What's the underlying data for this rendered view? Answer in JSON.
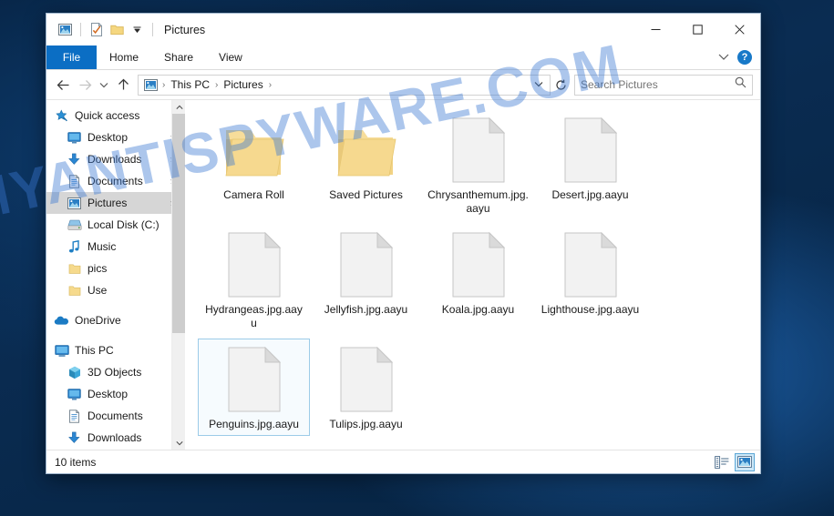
{
  "window": {
    "title": "Pictures",
    "quick_access": [
      {
        "name": "pictures-library-icon",
        "label": "Pictures library"
      },
      {
        "name": "properties-icon",
        "label": "Properties"
      },
      {
        "name": "new-folder-icon",
        "label": "New folder"
      },
      {
        "name": "customize-qat-icon",
        "label": "Customize Quick Access Toolbar"
      }
    ],
    "controls": {
      "minimize": "–",
      "maximize": "❐",
      "close": "✕"
    }
  },
  "ribbon": {
    "tabs": [
      {
        "label": "File",
        "active": true
      },
      {
        "label": "Home",
        "active": false
      },
      {
        "label": "Share",
        "active": false
      },
      {
        "label": "View",
        "active": false
      }
    ],
    "collapse_label": "⌄",
    "help_label": "?"
  },
  "address": {
    "back": "←",
    "forward": "→",
    "recent": "⌄",
    "up": "↑",
    "breadcrumbs": [
      "This PC",
      "Pictures"
    ],
    "separator": "›",
    "history_chevron": "⌄",
    "refresh": "↻"
  },
  "search": {
    "placeholder": "Search Pictures",
    "value": "",
    "icon": "search-icon"
  },
  "sidebar": {
    "items": [
      {
        "label": "Quick access",
        "icon": "star-pin-icon",
        "indent": 0,
        "pinned": false,
        "selected": false
      },
      {
        "label": "Desktop",
        "icon": "desktop-icon",
        "indent": 1,
        "pinned": true,
        "selected": false
      },
      {
        "label": "Downloads",
        "icon": "download-icon",
        "indent": 1,
        "pinned": true,
        "selected": false
      },
      {
        "label": "Documents",
        "icon": "documents-icon",
        "indent": 1,
        "pinned": true,
        "selected": false
      },
      {
        "label": "Pictures",
        "icon": "pictures-icon",
        "indent": 1,
        "pinned": true,
        "selected": true
      },
      {
        "label": "Local Disk (C:)",
        "icon": "disk-icon",
        "indent": 1,
        "pinned": false,
        "selected": false
      },
      {
        "label": "Music",
        "icon": "music-icon",
        "indent": 1,
        "pinned": false,
        "selected": false
      },
      {
        "label": "pics",
        "icon": "folder-icon",
        "indent": 1,
        "pinned": false,
        "selected": false
      },
      {
        "label": "Use",
        "icon": "folder-icon",
        "indent": 1,
        "pinned": false,
        "selected": false
      },
      {
        "label": "OneDrive",
        "icon": "onedrive-icon",
        "indent": 0,
        "pinned": false,
        "selected": false,
        "gap_before": true
      },
      {
        "label": "This PC",
        "icon": "thispc-icon",
        "indent": 0,
        "pinned": false,
        "selected": false,
        "gap_before": true
      },
      {
        "label": "3D Objects",
        "icon": "3dobjects-icon",
        "indent": 1,
        "pinned": false,
        "selected": false
      },
      {
        "label": "Desktop",
        "icon": "desktop-icon",
        "indent": 1,
        "pinned": false,
        "selected": false
      },
      {
        "label": "Documents",
        "icon": "documents-icon",
        "indent": 1,
        "pinned": false,
        "selected": false
      },
      {
        "label": "Downloads",
        "icon": "download-icon",
        "indent": 1,
        "pinned": false,
        "selected": false
      }
    ]
  },
  "files": [
    {
      "label": "Camera Roll",
      "type": "folder",
      "selected": false
    },
    {
      "label": "Saved Pictures",
      "type": "folder",
      "selected": false
    },
    {
      "label": "Chrysanthemum.jpg.aayu",
      "type": "file",
      "selected": false
    },
    {
      "label": "Desert.jpg.aayu",
      "type": "file",
      "selected": false
    },
    {
      "label": "Hydrangeas.jpg.aayu",
      "type": "file",
      "selected": false
    },
    {
      "label": "Jellyfish.jpg.aayu",
      "type": "file",
      "selected": false
    },
    {
      "label": "Koala.jpg.aayu",
      "type": "file",
      "selected": false
    },
    {
      "label": "Lighthouse.jpg.aayu",
      "type": "file",
      "selected": false
    },
    {
      "label": "Penguins.jpg.aayu",
      "type": "file",
      "selected": true
    },
    {
      "label": "Tulips.jpg.aayu",
      "type": "file",
      "selected": false
    }
  ],
  "status": {
    "item_count": "10 items",
    "views": [
      {
        "name": "details-view-button",
        "active": false
      },
      {
        "name": "large-icons-view-button",
        "active": true
      }
    ]
  },
  "watermark": {
    "text": "MYANTISPYWARE.COM"
  },
  "colors": {
    "accent": "#0b6ec4",
    "selection_border": "#9ccbe8",
    "folder": "#f5d57e",
    "desktop": "#062241"
  }
}
